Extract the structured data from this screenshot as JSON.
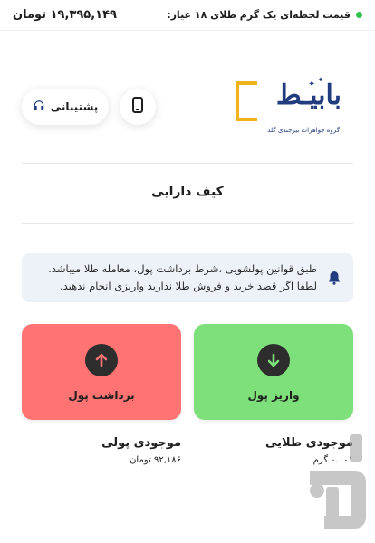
{
  "ticker": {
    "label": "قیمت لحظه‌ای یک گرم طلای ۱۸ عیار:",
    "price": "۱۹,۳۹۵,۱۴۹ تومان",
    "status_color": "#2fc24e"
  },
  "header": {
    "support_label": "پشتیبانی",
    "support_icon": "headset-icon",
    "phone_icon": "phone-icon",
    "logo": {
      "name": "بابیـط",
      "subtitle": "گروه جواهرات بیرجندی گلد"
    }
  },
  "page": {
    "title": "کیف دارایی"
  },
  "notice": {
    "icon": "bell-icon",
    "line1": "طبق قوانین پولشویی ،شرط برداشت پول، معامله طلا میباشد.",
    "line2": "لطفا اگر قصد خرید و فروش طلا ندارید واریزی انجام ندهید."
  },
  "actions": {
    "withdraw": {
      "label": "برداشت پول",
      "color": "#ff7373",
      "icon": "arrow-up-icon"
    },
    "deposit": {
      "label": "واریز پول",
      "color": "#7ee07a",
      "icon": "arrow-down-icon"
    }
  },
  "balances": {
    "money": {
      "title": "موجودی پولی",
      "value": "۹۲,۱۸۶ تومان"
    },
    "gold": {
      "title": "موجودی طلایی",
      "value": "۰.۰۰۱ گرم"
    }
  }
}
